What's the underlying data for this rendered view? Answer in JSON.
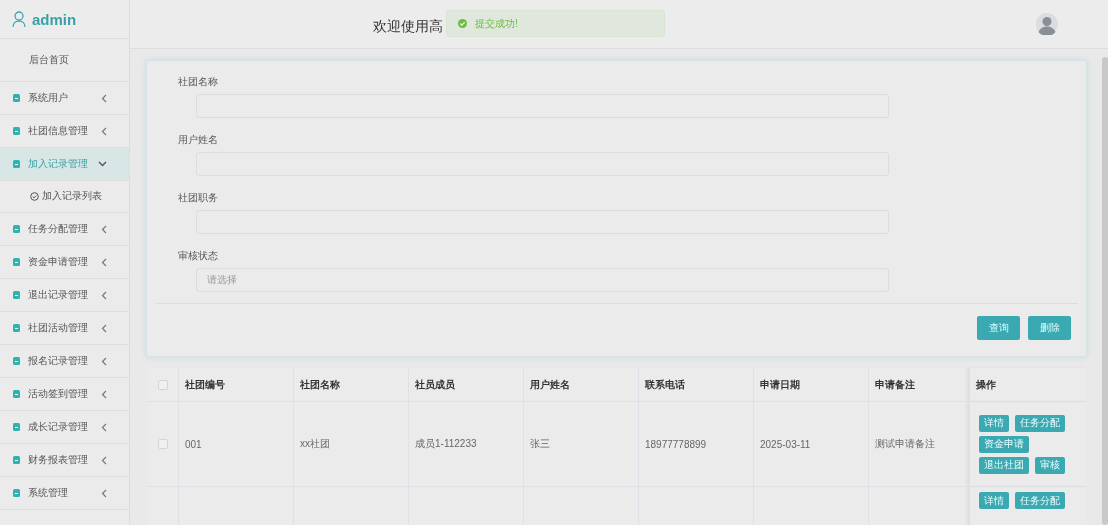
{
  "sidebar": {
    "user": "admin",
    "home": "后台首页",
    "items": [
      {
        "label": "系统用户",
        "expanded": false
      },
      {
        "label": "社团信息管理",
        "expanded": false
      },
      {
        "label": "加入记录管理",
        "expanded": true,
        "children": [
          {
            "label": "加入记录列表"
          }
        ]
      },
      {
        "label": "任务分配管理",
        "expanded": false
      },
      {
        "label": "资金申请管理",
        "expanded": false
      },
      {
        "label": "退出记录管理",
        "expanded": false
      },
      {
        "label": "社团活动管理",
        "expanded": false
      },
      {
        "label": "报名记录管理",
        "expanded": false
      },
      {
        "label": "活动签到管理",
        "expanded": false
      },
      {
        "label": "成长记录管理",
        "expanded": false
      },
      {
        "label": "财务报表管理",
        "expanded": false
      },
      {
        "label": "系统管理",
        "expanded": false
      }
    ]
  },
  "header": {
    "title": "欢迎使用高"
  },
  "toast": {
    "message": "提交成功!"
  },
  "search_form": {
    "fields": [
      {
        "label": "社团名称",
        "kind": "text"
      },
      {
        "label": "用户姓名",
        "kind": "text"
      },
      {
        "label": "社团职务",
        "kind": "text"
      },
      {
        "label": "审核状态",
        "kind": "select",
        "placeholder": "请选择"
      }
    ],
    "buttons": [
      "查询",
      "删除"
    ]
  },
  "table": {
    "select_all": {
      "checked": false
    },
    "columns": [
      "社团编号",
      "社团名称",
      "社员成员",
      "用户姓名",
      "联系电话",
      "申请日期",
      "申请备注",
      "操作"
    ],
    "rows": [
      {
        "checked": false,
        "cells": [
          "001",
          "xx社团",
          "成员1-112233",
          "张三",
          "18977778899",
          "2025-03-11",
          "测试申请备注"
        ],
        "actions": [
          [
            "详情",
            "任务分配"
          ],
          [
            "资金申请"
          ],
          [
            "退出社团",
            "审核"
          ]
        ]
      },
      {
        "actions": [
          [
            "详情",
            "任务分配"
          ]
        ]
      }
    ]
  }
}
